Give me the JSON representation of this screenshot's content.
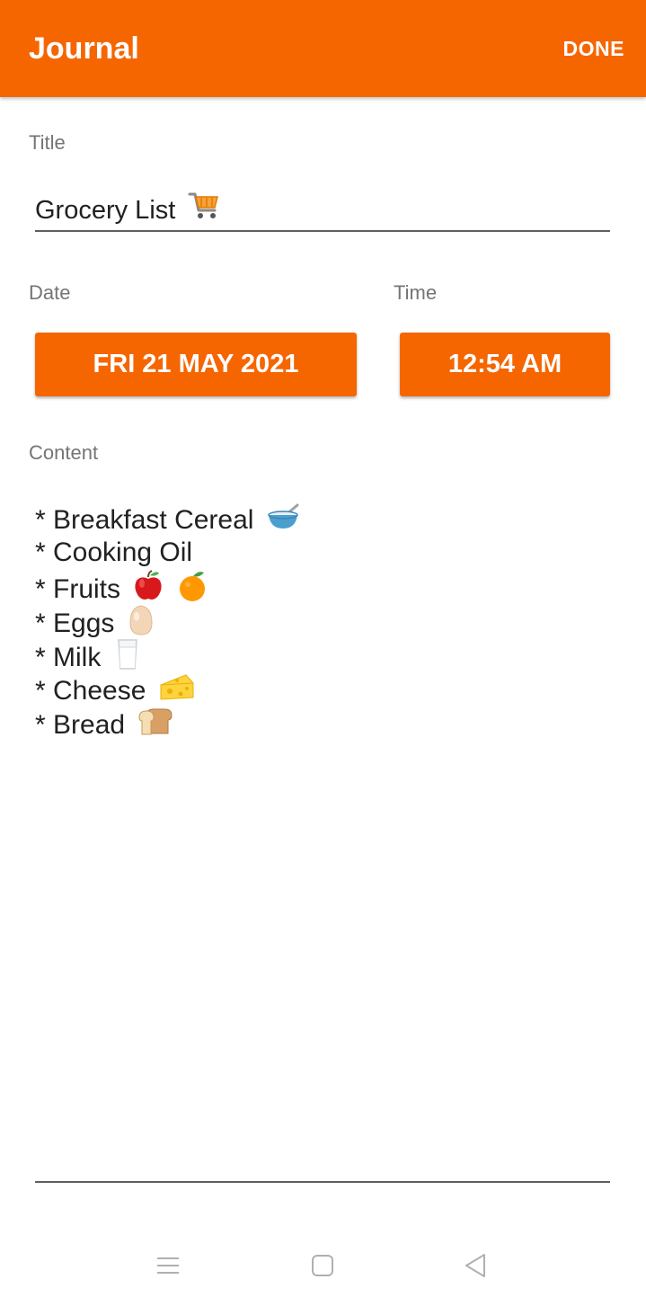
{
  "app_bar": {
    "title": "Journal",
    "done_label": "DONE"
  },
  "title_field": {
    "label": "Title",
    "value": "Grocery List",
    "icon": "shopping-cart-icon"
  },
  "date_field": {
    "label": "Date",
    "value": "FRI 21 MAY 2021"
  },
  "time_field": {
    "label": "Time",
    "value": "12:54 AM"
  },
  "content_field": {
    "label": "Content",
    "lines": [
      {
        "text": "* Breakfast Cereal",
        "icons": [
          "bowl-icon"
        ]
      },
      {
        "text": "* Cooking Oil",
        "icons": []
      },
      {
        "text": "* Fruits",
        "icons": [
          "apple-icon",
          "orange-icon"
        ]
      },
      {
        "text": "* Eggs",
        "icons": [
          "egg-icon"
        ]
      },
      {
        "text": "* Milk",
        "icons": [
          "milk-glass-icon"
        ]
      },
      {
        "text": "* Cheese",
        "icons": [
          "cheese-icon"
        ]
      },
      {
        "text": "* Bread",
        "icons": [
          "bread-icon"
        ]
      }
    ]
  },
  "nav_bar": {
    "icons": [
      "menu-icon",
      "home-square-icon",
      "back-triangle-icon"
    ]
  },
  "colors": {
    "accent": "#f56600",
    "label": "#757575",
    "text": "#212121",
    "underline": "#5f5f5f"
  }
}
